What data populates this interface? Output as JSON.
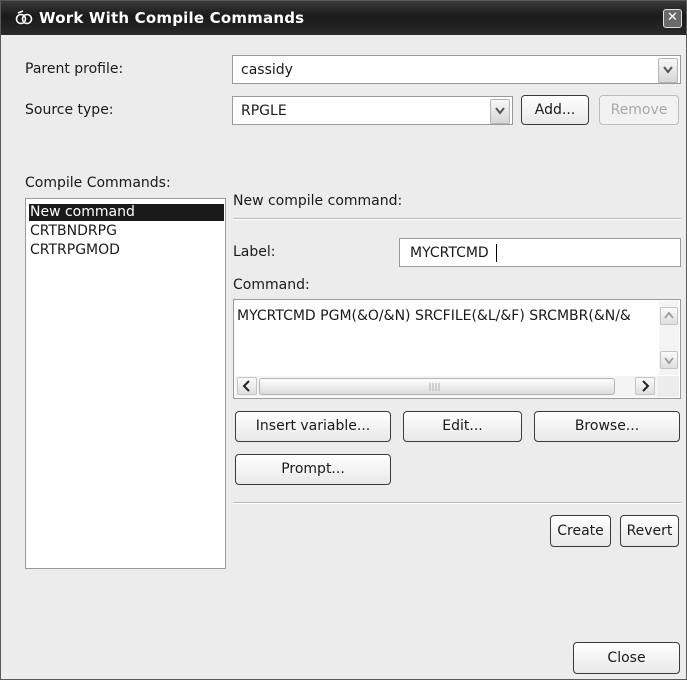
{
  "window": {
    "title": "Work With Compile Commands",
    "close_glyph": "✕",
    "icon": "compile-commands-icon"
  },
  "parent_profile": {
    "label": "Parent profile:",
    "value": "cassidy"
  },
  "source_type": {
    "label": "Source type:",
    "value": "RPGLE",
    "add_label": "Add...",
    "remove_label": "Remove"
  },
  "compile_commands": {
    "label": "Compile Commands:",
    "items": [
      {
        "label": "New command",
        "selected": true
      },
      {
        "label": "CRTBNDRPG",
        "selected": false
      },
      {
        "label": "CRTRPGMOD",
        "selected": false
      }
    ]
  },
  "editor": {
    "heading": "New compile command:",
    "label_caption": "Label:",
    "label_value": "MYCRTCMD",
    "command_caption": "Command:",
    "command_value": "MYCRTCMD PGM(&O/&N) SRCFILE(&L/&F) SRCMBR(&N/&",
    "insert_variable_label": "Insert variable...",
    "edit_label": "Edit...",
    "browse_label": "Browse...",
    "prompt_label": "Prompt...",
    "create_label": "Create",
    "revert_label": "Revert"
  },
  "footer": {
    "close_label": "Close"
  }
}
